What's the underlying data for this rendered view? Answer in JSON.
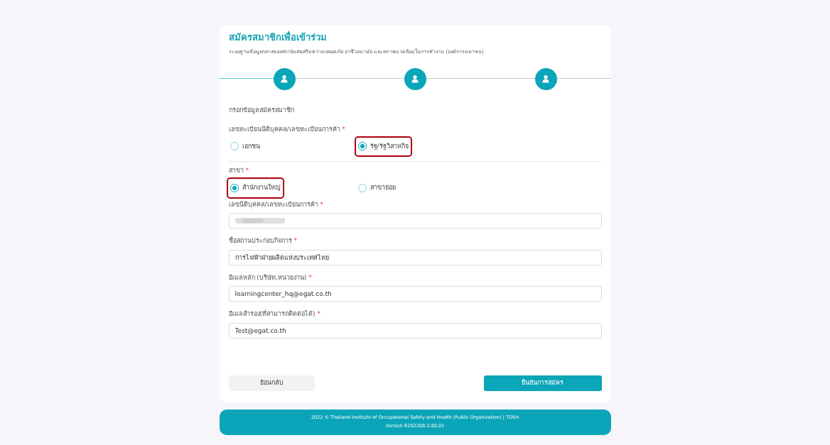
{
  "header": {
    "title": "สมัครสมาชิกเพื่อเข้าร่วม",
    "subtitle": "ระบบฐานข้อมูลกลางของสถาบันส่งเสริมความปลอดภัย อาชีวอนามัย และสภาพแวดล้อมในการทำงาน (องค์การมหาชน)"
  },
  "steps": [
    {
      "kind": "user"
    },
    {
      "kind": "user"
    },
    {
      "kind": "user"
    }
  ],
  "section_title": "กรอกข้อมูลสมัครสมาชิก",
  "radio_groups": [
    {
      "label": "เลขทะเบียนนิติบุคคล/เลขทะเบียนการค้า",
      "required_mark": "*",
      "options": [
        {
          "label": "เอกชน",
          "selected": false,
          "highlighted": false
        },
        {
          "label": "รัฐ/รัฐวิสาหกิจ",
          "selected": true,
          "highlighted": true
        }
      ]
    },
    {
      "label": "สาขา",
      "required_mark": "*",
      "options": [
        {
          "label": "สำนักงานใหญ่",
          "selected": true,
          "highlighted": true
        },
        {
          "label": "สาขาย่อย",
          "selected": false,
          "highlighted": false
        }
      ]
    }
  ],
  "fields": [
    {
      "label": "เลขนิติบุคคล/เลขทะเบียนการค้า",
      "required_mark": "*",
      "kind": "redacted"
    },
    {
      "label": "ชื่อสถานประกอบกิจการ",
      "required_mark": "*",
      "kind": "text",
      "value": "การไฟฟ้าฝ่ายผลิตแห่งประเทศไทย"
    },
    {
      "label": "อีเมลหลัก (บริษัท,หน่วยงาน)",
      "required_mark": "*",
      "kind": "text",
      "value": "learningcenter_hq@egat.co.th"
    },
    {
      "label": "อีเมลสำรอง(ที่สามารถติดต่อได้)",
      "required_mark": "*",
      "kind": "text",
      "value": "Test@egat.co.th"
    }
  ],
  "buttons": {
    "back": "ย้อนกลับ",
    "submit": "ยืนยันการสมัคร"
  },
  "footer": {
    "line1": "2022 © Thailand Institute of Occupational Safety and Health (Public Organization) | TOSH",
    "line2": "Version R202208-2.00.01"
  }
}
